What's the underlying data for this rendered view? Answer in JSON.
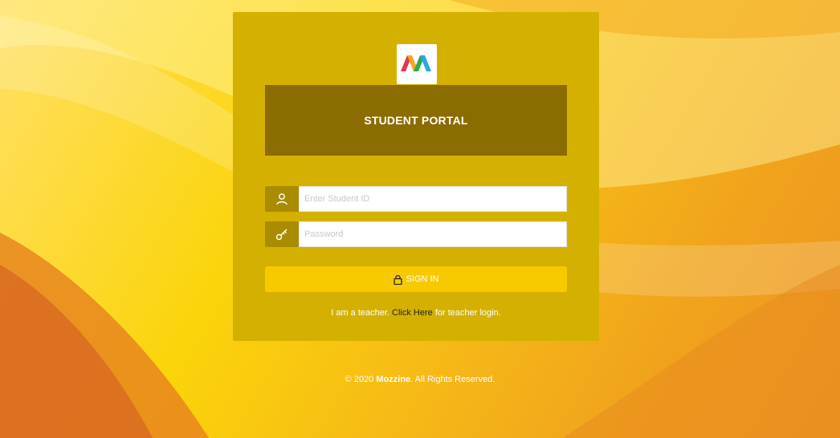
{
  "header": {
    "title": "STUDENT PORTAL"
  },
  "logo": {
    "icon": "mozzine-logo-icon"
  },
  "form": {
    "student_id": {
      "placeholder": "Enter Student ID",
      "value": "",
      "icon": "user-icon"
    },
    "password": {
      "placeholder": "Password",
      "value": "",
      "icon": "key-icon"
    },
    "signin_label": "SIGN IN",
    "signin_icon": "lock-icon"
  },
  "teacher": {
    "prefix": "I am a teacher.",
    "link": "Click Here",
    "suffix": "for teacher login."
  },
  "footer": {
    "copyright": "© 2020",
    "brand": "Mozzine",
    "rights": ". All Rights Reserved."
  },
  "colors": {
    "card": "#d4b100",
    "header": "#8b6c00",
    "addon": "#a98c00",
    "button": "#f7ca00"
  }
}
